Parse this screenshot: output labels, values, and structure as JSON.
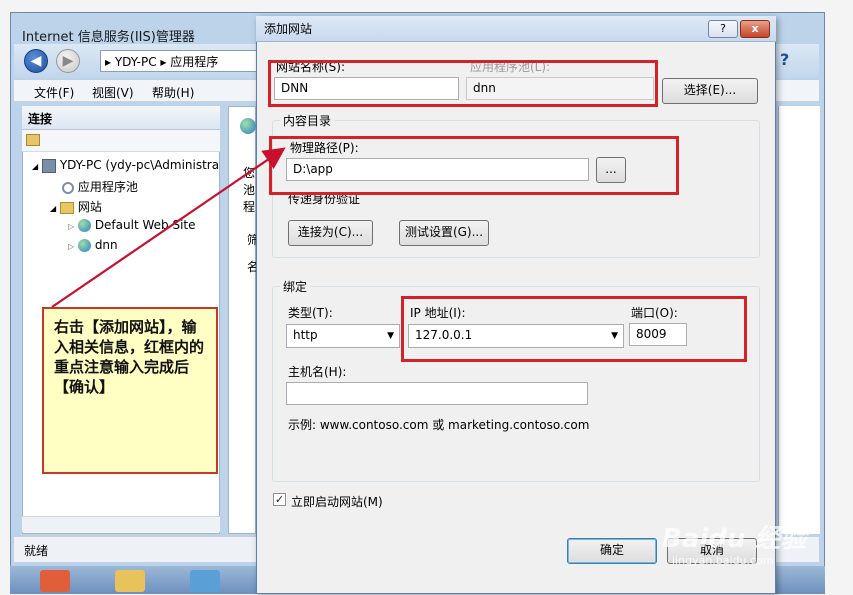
{
  "iis": {
    "title": "Internet 信息服务(IIS)管理器",
    "address": "▸ YDY-PC  ▸ 应用程序",
    "menu": [
      "文件(F)",
      "视图(V)",
      "帮助(H)"
    ],
    "connections_title": "连接",
    "tree": [
      "YDY-PC (ydy-pc\\Administra",
      "应用程序池",
      "网站",
      "Default Web Site",
      "dnn"
    ],
    "status": "就绪",
    "middle_fragments": [
      "您",
      "池",
      "程",
      "筛",
      "名"
    ]
  },
  "dialog": {
    "title": "添加网站",
    "help_btn": "?",
    "close_btn": "x",
    "site_name_label": "网站名称(S):",
    "site_name_value": "DNN",
    "app_pool_label": "应用程序池(L):",
    "app_pool_value": "dnn",
    "select_btn": "选择(E)...",
    "content_dir_label": "内容目录",
    "physical_path_label": "物理路径(P):",
    "physical_path_value": "D:\\app",
    "browse_btn": "...",
    "passthrough_label": "传递身份验证",
    "connect_as_btn": "连接为(C)...",
    "test_settings_btn": "测试设置(G)...",
    "binding_label": "绑定",
    "type_label": "类型(T):",
    "type_value": "http",
    "ip_label": "IP 地址(I):",
    "ip_value": "127.0.0.1",
    "port_label": "端口(O):",
    "port_value": "8009",
    "host_label": "主机名(H):",
    "host_value": "",
    "example_text": "示例: www.contoso.com 或 marketing.contoso.com",
    "start_now_label": "立即启动网站(M)",
    "start_now_checked": true,
    "ok_btn": "确定",
    "cancel_btn": "取消"
  },
  "note": {
    "text": "右击【添加网站】，输入相关信息，红框内的重点注意输入完成后【确认】"
  },
  "watermark": {
    "text": "Baidu 经验",
    "url": "jingyan.baidu.com"
  },
  "colors": {
    "highlight_red": "#d2232a",
    "note_bg": "#ffffc4",
    "arrow_red": "#c8102e"
  }
}
